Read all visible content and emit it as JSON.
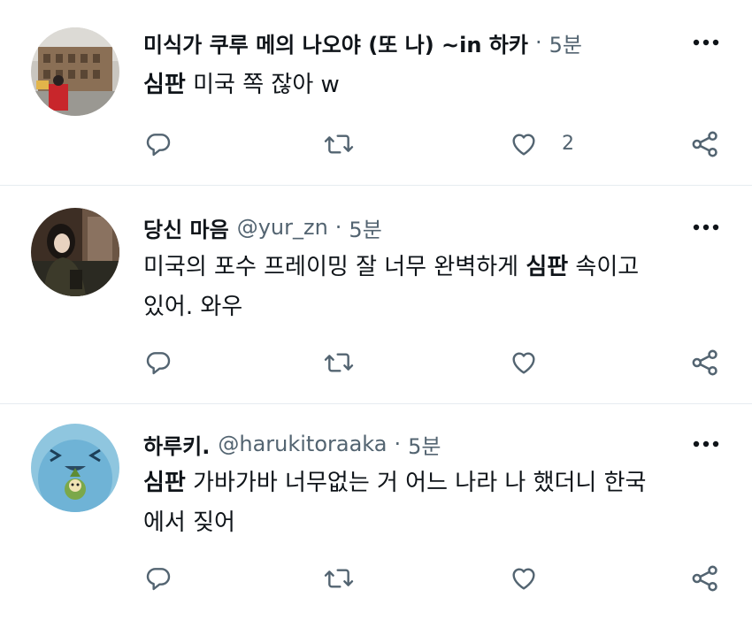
{
  "tweets": [
    {
      "name": "미식가 쿠루 메의 나오야 (또 나) ~in 하카",
      "handle": "",
      "time": "5분",
      "text_bold": "심판",
      "text_rest": " 미국 쪽 잖아 w",
      "like_count": "2"
    },
    {
      "name": "당신 마음",
      "handle": "@yur_zn",
      "time": "5분",
      "text_before": "미국의 포수 프레이밍 잘 너무 완벽하게 ",
      "text_bold": "심판",
      "text_after": " 속이고\n있어. 와우",
      "like_count": ""
    },
    {
      "name": "하루키.",
      "handle": "@harukitoraaka",
      "time": "5분",
      "text_bold": "심판",
      "text_rest": " 가바가바 너무없는 거 어느 나라 나 했더니 한국\n에서 짖어",
      "like_count": ""
    }
  ],
  "icons": {
    "reply": "reply-icon",
    "retweet": "retweet-icon",
    "like": "like-icon",
    "share": "share-icon",
    "more": "more-icon"
  },
  "colors": {
    "text": "#0f1419",
    "secondary": "#536471",
    "divider": "#e6ecf0"
  }
}
